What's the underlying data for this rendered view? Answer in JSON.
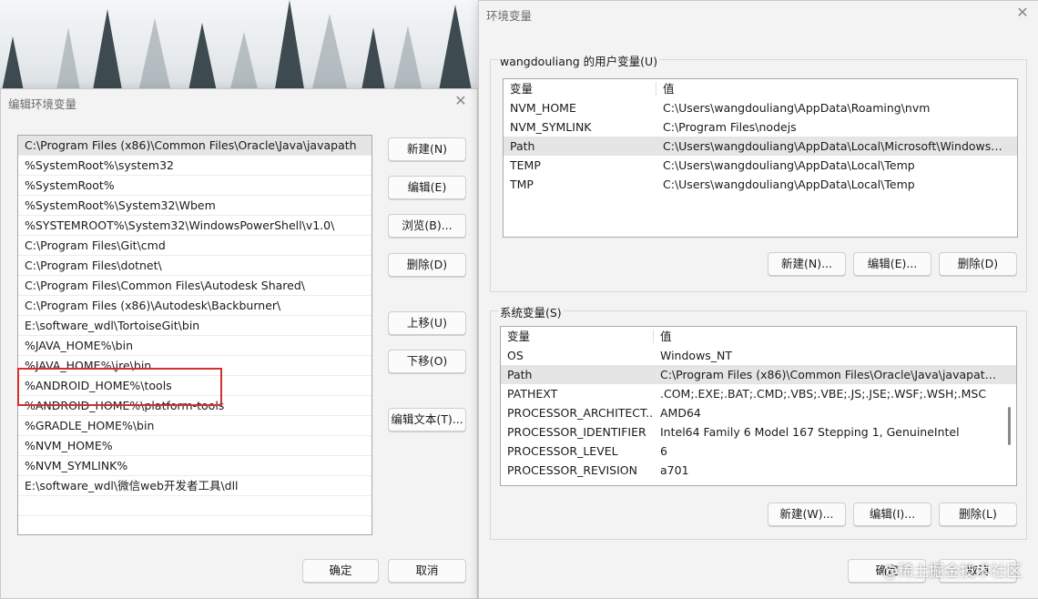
{
  "edit_dialog": {
    "title": "编辑环境变量",
    "paths": [
      "C:\\Program Files (x86)\\Common Files\\Oracle\\Java\\javapath",
      "%SystemRoot%\\system32",
      "%SystemRoot%",
      "%SystemRoot%\\System32\\Wbem",
      "%SYSTEMROOT%\\System32\\WindowsPowerShell\\v1.0\\",
      "C:\\Program Files\\Git\\cmd",
      "C:\\Program Files\\dotnet\\",
      "C:\\Program Files\\Common Files\\Autodesk Shared\\",
      "C:\\Program Files (x86)\\Autodesk\\Backburner\\",
      "E:\\software_wdl\\TortoiseGit\\bin",
      "%JAVA_HOME%\\bin",
      "%JAVA_HOME%\\jre\\bin",
      "%ANDROID_HOME%\\tools",
      "%ANDROID_HOME%\\platform-tools",
      "%GRADLE_HOME%\\bin",
      "%NVM_HOME%",
      "%NVM_SYMLINK%",
      "E:\\software_wdl\\微信web开发者工具\\dll",
      "",
      ""
    ],
    "buttons": {
      "new": "新建(N)",
      "edit": "编辑(E)",
      "browse": "浏览(B)...",
      "delete": "删除(D)",
      "move_up": "上移(U)",
      "move_down": "下移(O)",
      "edit_text": "编辑文本(T)...",
      "ok": "确定",
      "cancel": "取消"
    }
  },
  "env_dialog": {
    "title": "环境变量",
    "user_group": {
      "label": "wangdouliang 的用户变量(U)",
      "col_var": "变量",
      "col_val": "值",
      "rows": [
        {
          "name": "NVM_HOME",
          "value": "C:\\Users\\wangdouliang\\AppData\\Roaming\\nvm"
        },
        {
          "name": "NVM_SYMLINK",
          "value": "C:\\Program Files\\nodejs"
        },
        {
          "name": "Path",
          "value": "C:\\Users\\wangdouliang\\AppData\\Local\\Microsoft\\WindowsA..."
        },
        {
          "name": "TEMP",
          "value": "C:\\Users\\wangdouliang\\AppData\\Local\\Temp"
        },
        {
          "name": "TMP",
          "value": "C:\\Users\\wangdouliang\\AppData\\Local\\Temp"
        }
      ],
      "buttons": {
        "new": "新建(N)...",
        "edit": "编辑(E)...",
        "delete": "删除(D)"
      }
    },
    "system_group": {
      "label": "系统变量(S)",
      "col_var": "变量",
      "col_val": "值",
      "rows": [
        {
          "name": "OS",
          "value": "Windows_NT"
        },
        {
          "name": "Path",
          "value": "C:\\Program Files (x86)\\Common Files\\Oracle\\Java\\javapath;C:..."
        },
        {
          "name": "PATHEXT",
          "value": ".COM;.EXE;.BAT;.CMD;.VBS;.VBE;.JS;.JSE;.WSF;.WSH;.MSC"
        },
        {
          "name": "PROCESSOR_ARCHITECT...",
          "value": "AMD64"
        },
        {
          "name": "PROCESSOR_IDENTIFIER",
          "value": "Intel64 Family 6 Model 167 Stepping 1, GenuineIntel"
        },
        {
          "name": "PROCESSOR_LEVEL",
          "value": "6"
        },
        {
          "name": "PROCESSOR_REVISION",
          "value": "a701"
        }
      ],
      "buttons": {
        "new": "新建(W)...",
        "edit": "编辑(I)...",
        "delete": "删除(L)"
      }
    },
    "buttons": {
      "ok": "确定",
      "cancel": "取消"
    }
  },
  "watermark": "@稀土掘金技术社区",
  "icons": {
    "close": "close-icon"
  }
}
